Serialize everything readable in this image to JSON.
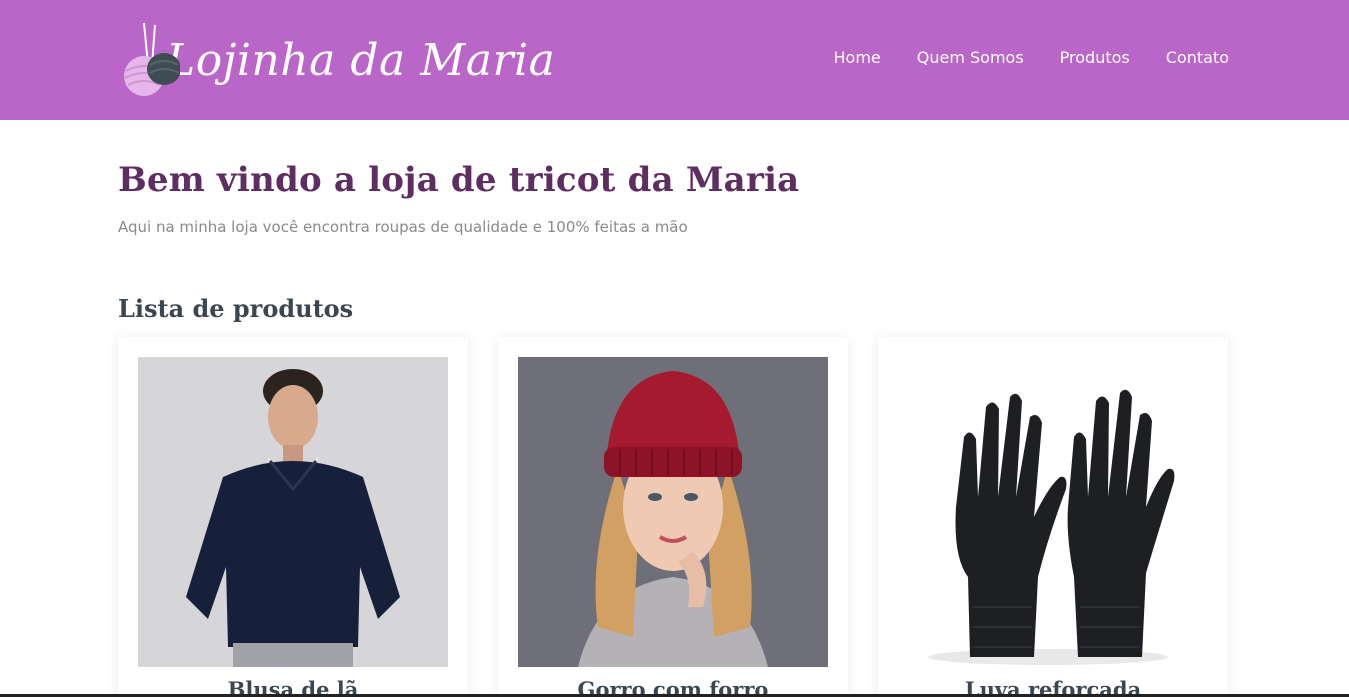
{
  "header": {
    "logo_text": "Lojinha da Maria",
    "background_color": "#b966c8",
    "nav": [
      {
        "label": "Home"
      },
      {
        "label": "Quem Somos"
      },
      {
        "label": "Produtos"
      },
      {
        "label": "Contato"
      }
    ]
  },
  "main": {
    "title": "Bem vindo a loja de tricot da Maria",
    "subtitle": "Aqui na minha loja você encontra roupas de qualidade e 100% feitas a mão",
    "products_heading": "Lista de produtos"
  },
  "products": [
    {
      "name": "Blusa de lã",
      "image": "man-wearing-navy-sweater"
    },
    {
      "name": "Gorro com forro",
      "image": "woman-wearing-red-beanie"
    },
    {
      "name": "Luva reforçada",
      "image": "black-knit-gloves"
    }
  ],
  "colors": {
    "accent": "#b966c8",
    "title": "#5e2d62",
    "heading": "#3c4650",
    "subtitle": "#8a8a8a"
  }
}
